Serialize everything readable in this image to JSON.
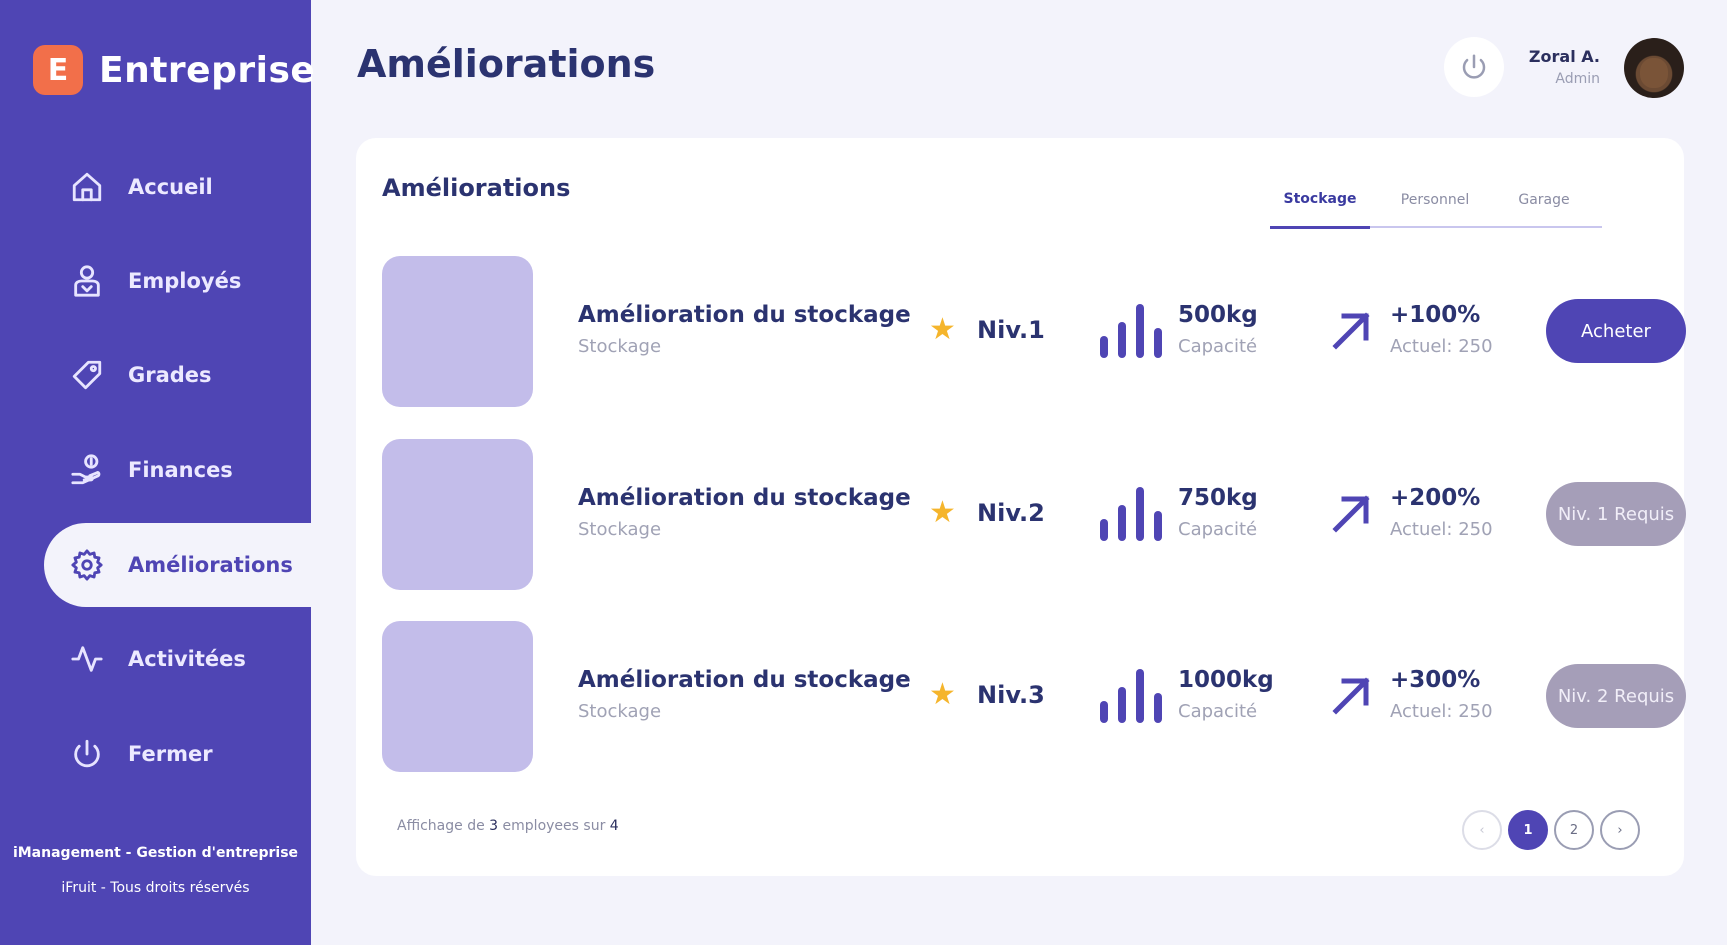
{
  "brand": {
    "logo_letter": "E",
    "name": "Entreprise"
  },
  "sidebar": {
    "items": [
      {
        "label": "Accueil",
        "icon": "home-icon"
      },
      {
        "label": "Employés",
        "icon": "user-icon"
      },
      {
        "label": "Grades",
        "icon": "tag-icon"
      },
      {
        "label": "Finances",
        "icon": "money-hand-icon"
      },
      {
        "label": "Améliorations",
        "icon": "gear-icon",
        "active": true
      },
      {
        "label": "Activitées",
        "icon": "activity-icon"
      },
      {
        "label": "Fermer",
        "icon": "power-icon"
      }
    ],
    "footer_title": "iManagement - Gestion d'entreprise",
    "footer_copy": "iFruit - Tous droits réservés"
  },
  "header": {
    "title": "Améliorations",
    "user_name": "Zoral A.",
    "user_role": "Admin"
  },
  "card": {
    "title": "Améliorations",
    "tabs": [
      {
        "label": "Stockage",
        "active": true
      },
      {
        "label": "Personnel"
      },
      {
        "label": "Garage"
      }
    ],
    "rows": [
      {
        "title": "Amélioration du stockage",
        "subtitle": "Stockage",
        "level": "Niv.1",
        "capacity": "500kg",
        "capacity_label": "Capacité",
        "increase": "+100%",
        "current": "Actuel: 250",
        "action": "Acheter",
        "action_state": "buy"
      },
      {
        "title": "Amélioration du stockage",
        "subtitle": "Stockage",
        "level": "Niv.2",
        "capacity": "750kg",
        "capacity_label": "Capacité",
        "increase": "+200%",
        "current": "Actuel: 250",
        "action": "Niv. 1 Requis",
        "action_state": "locked"
      },
      {
        "title": "Amélioration du stockage",
        "subtitle": "Stockage",
        "level": "Niv.3",
        "capacity": "1000kg",
        "capacity_label": "Capacité",
        "increase": "+300%",
        "current": "Actuel: 250",
        "action": "Niv. 2 Requis",
        "action_state": "locked"
      }
    ],
    "footer": {
      "prefix": "Affichage de",
      "shown": "3",
      "middle": "employees sur",
      "total": "4"
    },
    "pagination": {
      "prev": "‹",
      "pages": [
        "1",
        "2"
      ],
      "current": "1",
      "next": "›"
    }
  },
  "colors": {
    "accent": "#4f45b4",
    "brand_logo": "#f26f4a",
    "star": "#f5b52c",
    "locked": "#a59eb8"
  }
}
